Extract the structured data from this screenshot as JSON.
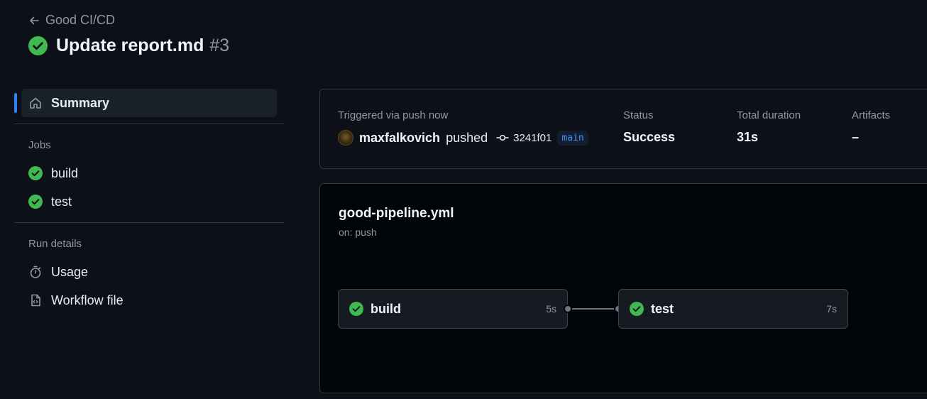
{
  "header": {
    "back_label": "Good CI/CD",
    "title": "Update report.md",
    "run_number": "#3"
  },
  "sidebar": {
    "summary_label": "Summary",
    "jobs_heading": "Jobs",
    "jobs": [
      {
        "label": "build"
      },
      {
        "label": "test"
      }
    ],
    "run_details_heading": "Run details",
    "usage_label": "Usage",
    "workflow_file_label": "Workflow file"
  },
  "summary": {
    "trigger_label": "Triggered via push now",
    "username": "maxfalkovich",
    "action": "pushed",
    "commit_sha": "3241f01",
    "branch": "main",
    "status_label": "Status",
    "status_value": "Success",
    "duration_label": "Total duration",
    "duration_value": "31s",
    "artifacts_label": "Artifacts",
    "artifacts_value": "–"
  },
  "workflow": {
    "file_name": "good-pipeline.yml",
    "trigger": "on: push",
    "jobs": [
      {
        "name": "build",
        "duration": "5s"
      },
      {
        "name": "test",
        "duration": "7s"
      }
    ]
  },
  "colors": {
    "success": "#3fb950",
    "accent": "#2f81f7",
    "background": "#0d1117"
  }
}
